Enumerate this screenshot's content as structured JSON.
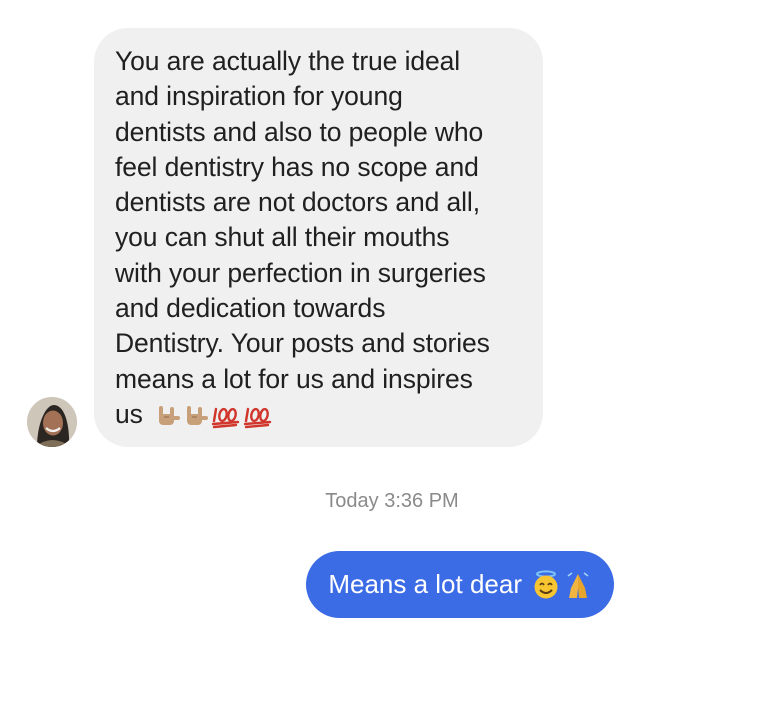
{
  "conversation": {
    "received_message": {
      "lines": [
        "You are actually the true ideal",
        "and inspiration for young",
        "dentists and also to people who",
        "feel dentistry has no scope and",
        "dentists are not doctors and all,",
        "you can shut all their mouths",
        "with your perfection in surgeries",
        "and dedication towards",
        "Dentistry. Your posts and stories",
        "means a lot for us and inspires"
      ],
      "last_word": "us",
      "emojis": [
        "rock-on-hand-icon",
        "rock-on-hand-icon",
        "hundred-points-icon",
        "hundred-points-icon"
      ]
    },
    "timestamp": "Today 3:36 PM",
    "sent_message": {
      "text": "Means a lot dear",
      "emojis": [
        "smiling-halo-face-icon",
        "folded-hands-icon"
      ]
    }
  },
  "colors": {
    "sent_bubble": "#3c6be6",
    "received_bubble": "#f0f0f0",
    "timestamp": "#8a8a8a"
  }
}
